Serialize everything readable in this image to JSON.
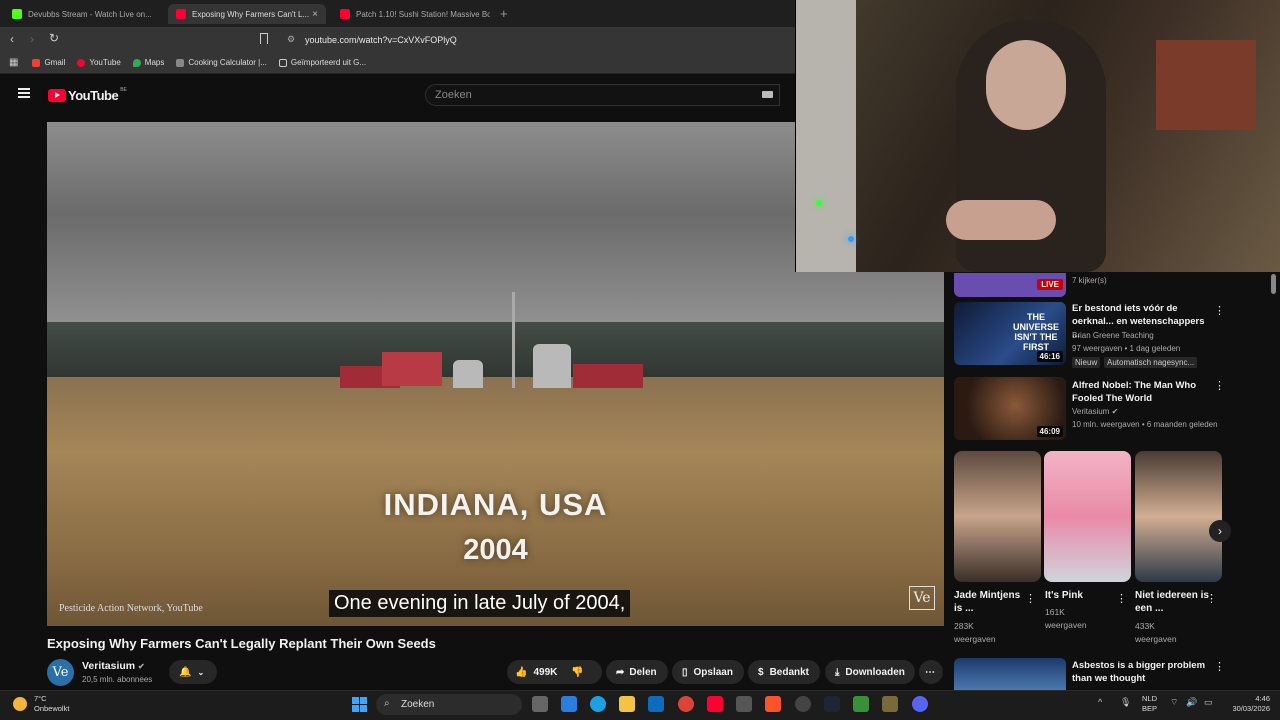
{
  "browser": {
    "tabs": [
      {
        "label": "Devubbs Stream - Watch Live on..."
      },
      {
        "label": "Exposing Why Farmers Can't L..."
      },
      {
        "label": "Patch 1.10! Sushi Station! Massive Bo..."
      }
    ],
    "url": "youtube.com/watch?v=CxVXvFOPlyQ",
    "bookmarks": [
      {
        "label": "Gmail"
      },
      {
        "label": "YouTube"
      },
      {
        "label": "Maps"
      },
      {
        "label": "Cooking Calculator |..."
      },
      {
        "label": "Geïmporteerd uit G..."
      }
    ]
  },
  "youtube": {
    "logo": "YouTube",
    "region": "BE",
    "search_placeholder": "Zoeken"
  },
  "video": {
    "overlay_place": "INDIANA, USA",
    "overlay_year": "2004",
    "caption": "One evening in late July of 2004,",
    "credit": "Pesticide Action Network, YouTube",
    "corner_logo": "Ve",
    "title": "Exposing Why Farmers Can't Legally Replant Their Own Seeds",
    "channel": "Veritasium",
    "channel_initials": "Ve",
    "subscribers": "20,5 mln. abonnees",
    "likes": "499K",
    "share": "Delen",
    "save": "Opslaan",
    "thanks": "Bedankt",
    "download": "Downloaden"
  },
  "sidebar": {
    "live_badge": "LIVE",
    "live_viewers": "7 kijker(s)",
    "recs": [
      {
        "title": "Er bestond iets vóór de oerknal... en wetenschappers ...",
        "channel": "Brian Greene Teaching",
        "meta": "97 weergaven • 1 dag geleden",
        "badge": "Nieuw",
        "badge2": "Automatisch nagesync...",
        "duration": "46:16",
        "thumb_text": "THE UNIVERSE ISN'T THE FIRST"
      },
      {
        "title": "Alfred Nobel: The Man Who Fooled The World",
        "channel": "Veritasium",
        "meta": "10 mln. weergaven • 6 maanden geleden",
        "duration": "46:09"
      },
      {
        "title": "Asbestos is a bigger problem than we thought"
      }
    ],
    "shorts": [
      {
        "title": "Jade Mintjens is ...",
        "views": "283K",
        "unit": "weergaven"
      },
      {
        "title": "It's Pink",
        "views": "161K",
        "unit": "weergaven"
      },
      {
        "title": "Niet iedereen is een ...",
        "views": "433K",
        "unit": "weergaven"
      }
    ]
  },
  "taskbar": {
    "weather_temp": "7°C",
    "weather_desc": "Onbewolkt",
    "search": "Zoeken",
    "lang1": "NLD",
    "lang2": "BEP",
    "time": "4:46",
    "date": "30/03/2026"
  }
}
